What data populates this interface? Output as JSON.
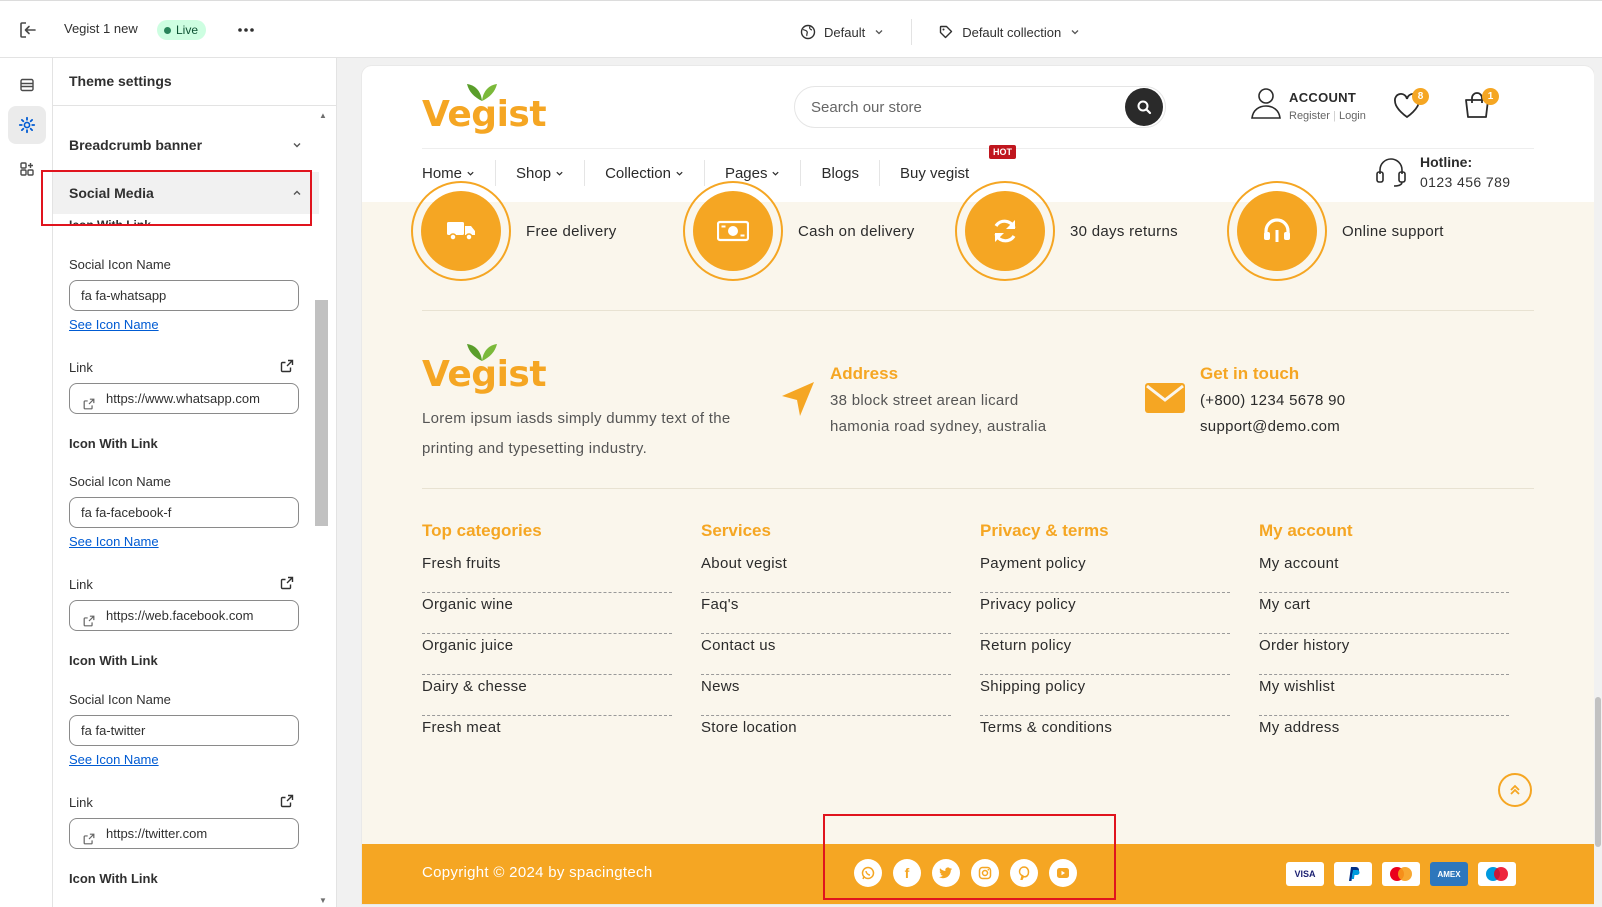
{
  "topbar": {
    "theme_name": "Vegist 1 new",
    "live_label": "Live",
    "locale_label": "Default",
    "collection_label": "Default collection"
  },
  "panel": {
    "title": "Theme settings",
    "sections": [
      {
        "label": "Breadcrumb banner",
        "open": false
      },
      {
        "label": "Social Media",
        "open": true
      }
    ],
    "cut_label": "Icon With Link",
    "groups": [
      {
        "heading": "",
        "icon_label": "Social Icon Name",
        "icon_value": "fa fa-whatsapp",
        "see_link": "See Icon Name",
        "link_label": "Link",
        "link_value": "https://www.whatsapp.com"
      },
      {
        "heading": "Icon With Link",
        "icon_label": "Social Icon Name",
        "icon_value": "fa fa-facebook-f",
        "see_link": "See Icon Name",
        "link_label": "Link",
        "link_value": "https://web.facebook.com"
      },
      {
        "heading": "Icon With Link",
        "icon_label": "Social Icon Name",
        "icon_value": "fa fa-twitter",
        "see_link": "See Icon Name",
        "link_label": "Link",
        "link_value": "https://twitter.com"
      },
      {
        "heading": "Icon With Link"
      }
    ]
  },
  "store": {
    "logo_text": "Vegist",
    "search_placeholder": "Search our store",
    "account_title": "ACCOUNT",
    "account_register": "Register",
    "account_login": "Login",
    "wishlist_count": "8",
    "cart_count": "1",
    "nav": [
      {
        "label": "Home",
        "dropdown": true
      },
      {
        "label": "Shop",
        "dropdown": true
      },
      {
        "label": "Collection",
        "dropdown": true
      },
      {
        "label": "Pages",
        "dropdown": true
      },
      {
        "label": "Blogs",
        "dropdown": false
      },
      {
        "label": "Buy vegist",
        "dropdown": false
      }
    ],
    "hot_badge": "HOT",
    "hotline_title": "Hotline:",
    "hotline_number": "0123 456 789",
    "services": [
      {
        "label": "Free delivery",
        "icon": "truck-icon"
      },
      {
        "label": "Cash on delivery",
        "icon": "cash-icon"
      },
      {
        "label": "30 days returns",
        "icon": "refresh-icon"
      },
      {
        "label": "Online support",
        "icon": "support-icon"
      }
    ],
    "about_text": "Lorem ipsum iasds simply dummy text of the printing and typesetting industry.",
    "address_title": "Address",
    "address_line1": "38 block street arean licard",
    "address_line2": "hamonia road sydney, australia",
    "contact_title": "Get in touch",
    "contact_phone": "(+800) 1234 5678 90",
    "contact_email": "support@demo.com",
    "columns": [
      {
        "title": "Top categories",
        "items": [
          "Fresh fruits",
          "Organic wine",
          "Organic juice",
          "Dairy & chesse",
          "Fresh meat"
        ]
      },
      {
        "title": "Services",
        "items": [
          "About vegist",
          "Faq's",
          "Contact us",
          "News",
          "Store location"
        ]
      },
      {
        "title": "Privacy & terms",
        "items": [
          "Payment policy",
          "Privacy policy",
          "Return policy",
          "Shipping policy",
          "Terms & conditions"
        ]
      },
      {
        "title": "My account",
        "items": [
          "My account",
          "My cart",
          "Order history",
          "My wishlist",
          "My address"
        ]
      }
    ],
    "copyright": "Copyright © 2024 by spacingtech",
    "socials": [
      "whatsapp-icon",
      "facebook-icon",
      "twitter-icon",
      "instagram-icon",
      "pinterest-icon",
      "youtube-icon"
    ],
    "payments": [
      "VISA",
      "PayPal",
      "Mastercard",
      "AMEX",
      "Maestro"
    ]
  },
  "colors": {
    "brand": "#f5a623",
    "highlight": "#e0141e",
    "hot": "#c0161e"
  }
}
